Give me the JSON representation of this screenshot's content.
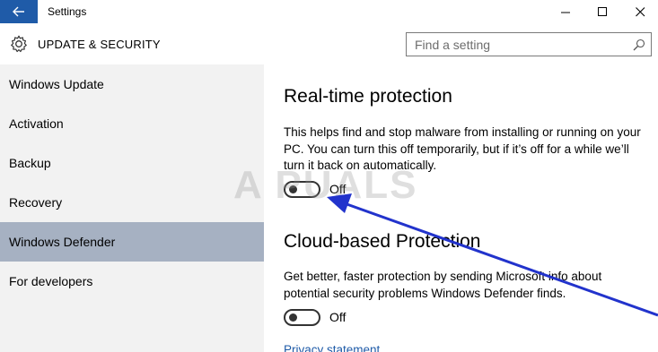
{
  "window": {
    "title": "Settings",
    "back_icon": "arrow-left-icon",
    "controls": [
      "minimize-icon",
      "maximize-icon",
      "close-icon"
    ]
  },
  "header": {
    "icon": "gear-icon",
    "title": "UPDATE & SECURITY"
  },
  "search": {
    "placeholder": "Find a setting",
    "icon": "search-icon"
  },
  "sidebar": {
    "items": [
      {
        "label": "Windows Update"
      },
      {
        "label": "Activation"
      },
      {
        "label": "Backup"
      },
      {
        "label": "Recovery"
      },
      {
        "label": "Windows Defender",
        "selected": true
      },
      {
        "label": "For developers"
      }
    ]
  },
  "content": {
    "realtime": {
      "title": "Real-time protection",
      "description": "This helps find and stop malware from installing or running on your PC. You can turn this off temporarily, but if it’s off for a while we’ll turn it back on automatically.",
      "toggle_state": "Off"
    },
    "cloud": {
      "title": "Cloud-based Protection",
      "description": "Get better, faster protection by sending Microsoft info about potential security problems Windows Defender finds.",
      "toggle_state": "Off"
    },
    "privacy_link": "Privacy statement"
  },
  "watermark": "A  PUALS",
  "colors": {
    "accent": "#1f5ba8",
    "sidebar_bg": "#f2f2f2",
    "selected_bg": "#a6b1c2",
    "annotation_arrow": "#2233cc"
  }
}
